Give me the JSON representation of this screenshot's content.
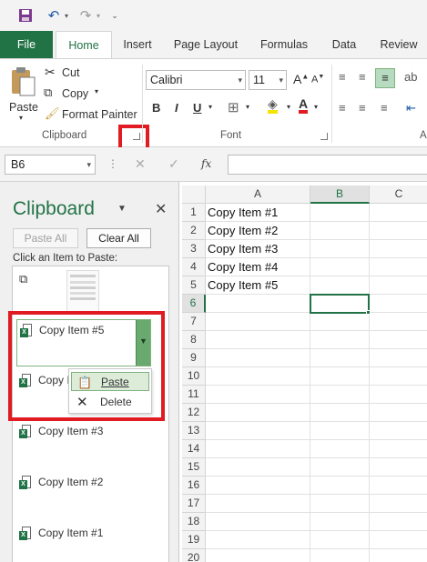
{
  "tabs": [
    "File",
    "Home",
    "Insert",
    "Page Layout",
    "Formulas",
    "Data",
    "Review"
  ],
  "ribbon": {
    "clipboard": {
      "paste_label": "Paste",
      "cut_label": "Cut",
      "copy_label": "Copy",
      "format_painter_label": "Format Painter",
      "group_label": "Clipboard"
    },
    "font": {
      "font_name": "Calibri",
      "font_size": "11",
      "bold": "B",
      "italic": "I",
      "underline": "U",
      "group_label": "Font"
    },
    "alignment_group_label": "A"
  },
  "formula_bar": {
    "name_box": "B6",
    "fx_label": "fx",
    "formula_value": ""
  },
  "clipboard_pane": {
    "title": "Clipboard",
    "paste_all": "Paste All",
    "clear_all": "Clear All",
    "hint": "Click an Item to Paste:",
    "items": [
      "Copy Item #5",
      "Copy It",
      "Copy Item #3",
      "Copy Item #2",
      "Copy Item #1"
    ],
    "context_menu": {
      "paste": "Paste",
      "delete": "Delete"
    }
  },
  "sheet": {
    "columns": [
      "A",
      "B",
      "C"
    ],
    "rows": [
      "1",
      "2",
      "3",
      "4",
      "5",
      "6",
      "7",
      "8",
      "9",
      "10",
      "11",
      "12",
      "13",
      "14",
      "15",
      "16",
      "17",
      "18",
      "19",
      "20"
    ],
    "cells_A": [
      "Copy Item #1",
      "Copy Item #2",
      "Copy Item #3",
      "Copy Item #4",
      "Copy Item #5"
    ],
    "selected_cell": "B6"
  },
  "colors": {
    "excel_green": "#217346",
    "highlight_red": "#e11b22",
    "menu_highlight": "#dcecd9"
  }
}
